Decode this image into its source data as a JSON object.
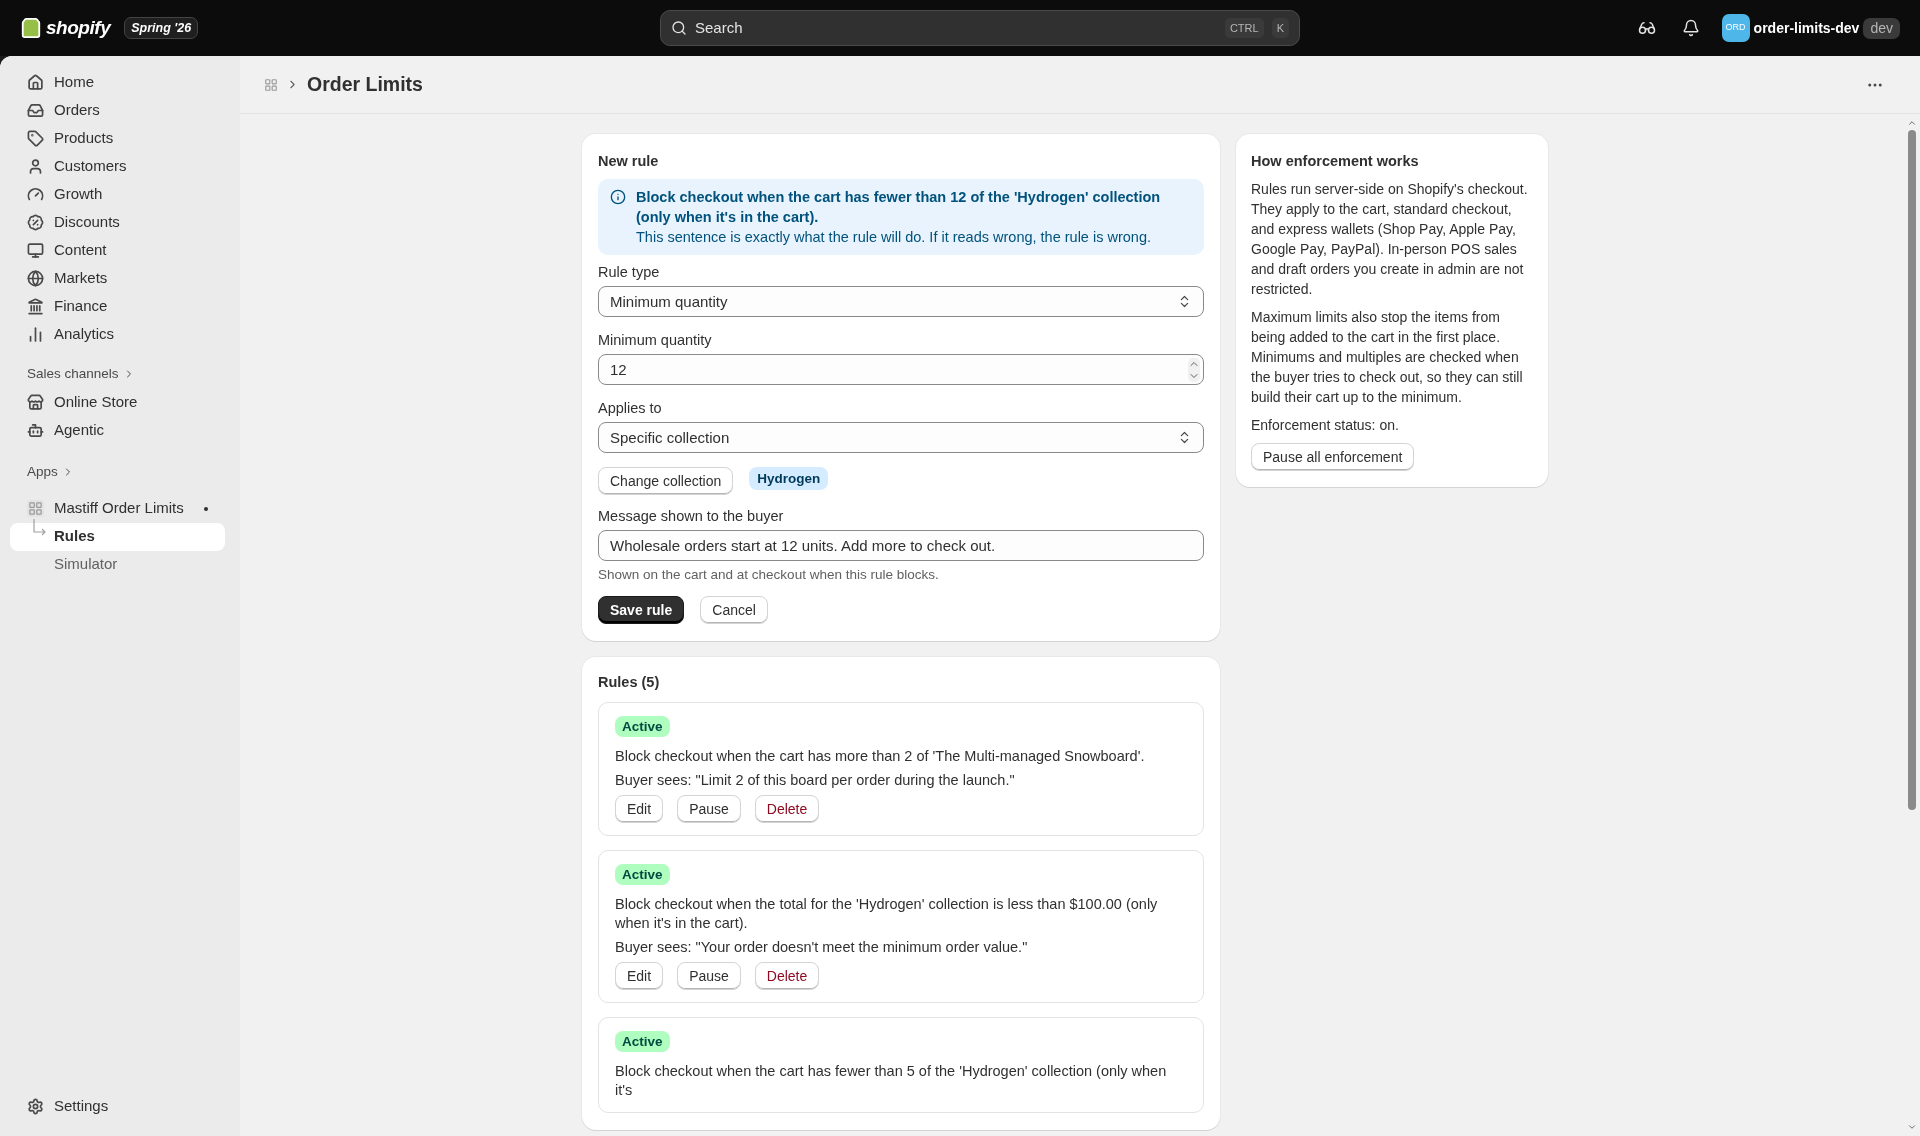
{
  "topbar": {
    "brand": "shopify",
    "edition": "Spring '26",
    "search": {
      "placeholder": "Search",
      "shortcut": [
        "CTRL",
        "K"
      ]
    },
    "store": {
      "avatar": "ORD",
      "name": "order-limits-dev",
      "tag": "dev"
    }
  },
  "sidebar": {
    "items": [
      {
        "label": "Home",
        "kind": "home",
        "selected": false
      },
      {
        "label": "Orders",
        "kind": "orders",
        "selected": false
      },
      {
        "label": "Products",
        "kind": "products",
        "selected": false
      },
      {
        "label": "Customers",
        "kind": "customers",
        "selected": false
      },
      {
        "label": "Growth",
        "kind": "growth",
        "selected": false
      },
      {
        "label": "Discounts",
        "kind": "discounts",
        "selected": false
      },
      {
        "label": "Content",
        "kind": "content",
        "selected": false
      },
      {
        "label": "Markets",
        "kind": "markets",
        "selected": false
      },
      {
        "label": "Finance",
        "kind": "finance",
        "selected": false
      },
      {
        "label": "Analytics",
        "kind": "analytics",
        "selected": false
      }
    ],
    "sales_channels": {
      "label": "Sales channels",
      "items": [
        {
          "label": "Online Store",
          "kind": "store",
          "selected": false
        },
        {
          "label": "Agentic",
          "kind": "agentic",
          "selected": false
        }
      ]
    },
    "apps": {
      "label": "Apps",
      "items": [
        {
          "label": "Mastiff Order Limits",
          "selected": false,
          "children": [
            {
              "label": "Rules",
              "selected": true
            },
            {
              "label": "Simulator",
              "selected": false
            }
          ]
        }
      ]
    },
    "settings": {
      "label": "Settings"
    }
  },
  "page": {
    "title": "Order Limits"
  },
  "new_rule": {
    "title": "New rule",
    "banner": {
      "title": "Block checkout when the cart has fewer than 12 of the 'Hydrogen' collection (only when it's in the cart).",
      "body": "This sentence is exactly what the rule will do. If it reads wrong, the rule is wrong."
    },
    "rule_type": {
      "label": "Rule type",
      "value": "Minimum quantity"
    },
    "minimum_quantity": {
      "label": "Minimum quantity",
      "value": "12"
    },
    "applies_to": {
      "label": "Applies to",
      "value": "Specific collection"
    },
    "collection": {
      "button": "Change collection",
      "tag": "Hydrogen"
    },
    "message": {
      "label": "Message shown to the buyer",
      "value": "Wholesale orders start at 12 units. Add more to check out.",
      "help": "Shown on the cart and at checkout when this rule blocks."
    },
    "buttons": [
      {
        "label": "Save rule",
        "kind": "primary"
      },
      {
        "label": "Cancel",
        "kind": "secondary"
      }
    ]
  },
  "enforcement": {
    "title": "How enforcement works",
    "paragraphs": [
      "Rules run server-side on Shopify's checkout. They apply to the cart, standard checkout, and express wallets (Shop Pay, Apple Pay, Google Pay, PayPal). In-person POS sales and draft orders you create in admin are not restricted.",
      "Maximum limits also stop the items from being added to the cart in the first place. Minimums and multiples are checked when the buyer tries to check out, so they can still build their cart up to the minimum.",
      "Enforcement status: on."
    ],
    "button": "Pause all enforcement"
  },
  "rules": {
    "title": "Rules (5)",
    "items": [
      {
        "status": "Active",
        "kind": "active",
        "text": "Block checkout when the cart has more than 2 of 'The Multi-managed Snowboard'.",
        "buyer_sees": "Buyer sees: \"Limit 2 of this board per order during the launch.\"",
        "actions": [
          {
            "label": "Edit",
            "kind": "default"
          },
          {
            "label": "Pause",
            "kind": "default"
          },
          {
            "label": "Delete",
            "kind": "critical"
          }
        ]
      },
      {
        "status": "Active",
        "kind": "active",
        "text": "Block checkout when the total for the 'Hydrogen' collection is less than $100.00 (only when it's in the cart).",
        "buyer_sees": "Buyer sees: \"Your order doesn't meet the minimum order value.\"",
        "actions": [
          {
            "label": "Edit",
            "kind": "default"
          },
          {
            "label": "Pause",
            "kind": "default"
          },
          {
            "label": "Delete",
            "kind": "critical"
          }
        ]
      },
      {
        "status": "Active",
        "kind": "active",
        "text": "Block checkout when the cart has fewer than 5 of the 'Hydrogen' collection (only when it's"
      }
    ]
  }
}
